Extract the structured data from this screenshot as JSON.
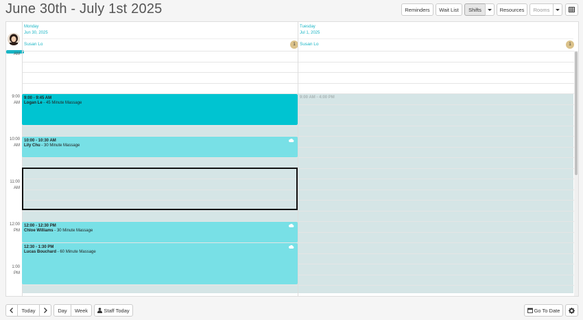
{
  "header": {
    "title": "June 30th - July 1st 2025",
    "buttons": {
      "reminders": "Reminders",
      "wait_list": "Wait List",
      "shifts": "Shifts",
      "resources": "Resources",
      "rooms": "Rooms"
    }
  },
  "columns": [
    {
      "day": "Monday",
      "date": "Jun 30, 2025",
      "staff": "Susan Lo",
      "count": "1"
    },
    {
      "day": "Tuesday",
      "date": "Jul 1, 2025",
      "staff": "Susan Lo",
      "count": "1"
    }
  ],
  "time_labels": [
    {
      "h": "",
      "ap": "AM"
    },
    {
      "h": "9:00",
      "ap": "AM"
    },
    {
      "h": "10:00",
      "ap": "AM"
    },
    {
      "h": "11:00",
      "ap": "AM"
    },
    {
      "h": "12:00",
      "ap": "PM"
    },
    {
      "h": "1:00",
      "ap": "PM"
    }
  ],
  "appointments": [
    {
      "time": "9:00 - 9:45 AM",
      "client": "Logan Le",
      "service": " - 45 Minute Massage"
    },
    {
      "time": "10:00 - 10:30 AM",
      "client": "Lily Chu",
      "service": " - 30 Minute Massage"
    },
    {
      "time": "12:00 - 12:30 PM",
      "client": "Chloe Williams",
      "service": " - 30 Minute Massage"
    },
    {
      "time": "12:30 - 1:30 PM",
      "client": "Lucas Bouchard",
      "service": " - 60 Minute Massage"
    }
  ],
  "shift_label": "9:00 AM - 4:00 PM",
  "footer": {
    "today": "Today",
    "day": "Day",
    "week": "Week",
    "staff_today": "Staff Today",
    "go_to_date": "Go To Date"
  },
  "colors": {
    "accent": "#19b5c5",
    "appt_dark": "#00c4d1",
    "appt_light": "#78e0e6",
    "closed": "#d5e5e6",
    "badge": "#dbc28a"
  },
  "icons": [
    "chevron-left-icon",
    "chevron-right-icon",
    "user-icon",
    "calendar-icon",
    "gear-icon",
    "table-icon",
    "cloud-icon",
    "chevron-down-icon"
  ]
}
